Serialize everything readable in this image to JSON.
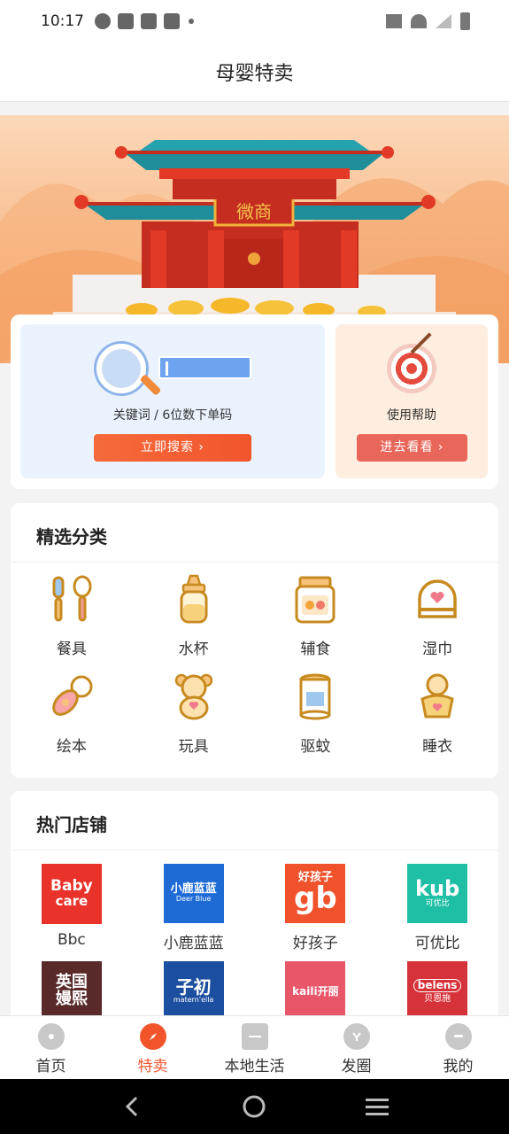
{
  "status_bar": {
    "time": "10:17"
  },
  "header": {
    "title": "母婴特卖"
  },
  "banner": {
    "sign_text": "微商"
  },
  "search_card": {
    "label": "关键词 / 6位数下单码",
    "button": "立即搜索 ›"
  },
  "help_card": {
    "label": "使用帮助",
    "button": "进去看看 ›"
  },
  "categories": {
    "title": "精选分类",
    "items": [
      {
        "label": "餐具",
        "icon": "tableware-icon"
      },
      {
        "label": "水杯",
        "icon": "baby-bottle-icon"
      },
      {
        "label": "辅食",
        "icon": "baby-food-jar-icon"
      },
      {
        "label": "湿巾",
        "icon": "wet-wipes-icon"
      },
      {
        "label": "绘本",
        "icon": "pacifier-icon"
      },
      {
        "label": "玩具",
        "icon": "teddy-bear-icon"
      },
      {
        "label": "驱蚊",
        "icon": "milk-powder-can-icon"
      },
      {
        "label": "睡衣",
        "icon": "baby-icon"
      }
    ]
  },
  "shops": {
    "title": "热门店铺",
    "items": [
      {
        "name": "Bbc",
        "logo_line1": "Baby",
        "logo_line2": "care",
        "color": "#e8322a"
      },
      {
        "name": "小鹿蓝蓝",
        "logo_line1": "小鹿蓝蓝",
        "logo_line2": "Deer Blue",
        "color": "#1e6bd6"
      },
      {
        "name": "好孩子",
        "logo_line1": "好孩子",
        "logo_line2": "gb",
        "color": "#f0522c"
      },
      {
        "name": "可优比",
        "logo_line1": "kub",
        "logo_line2": "可优比",
        "color": "#1fbfa6"
      },
      {
        "name": "",
        "logo_line1": "英国",
        "logo_line2": "嫚熙",
        "color": "#5a2a2a"
      },
      {
        "name": "",
        "logo_line1": "子初",
        "logo_line2": "matern'ella",
        "color": "#1d4fa0"
      },
      {
        "name": "",
        "logo_line1": "kaili开丽",
        "logo_line2": "",
        "color": "#e8566a"
      },
      {
        "name": "",
        "logo_line1": "belens",
        "logo_line2": "贝恩施",
        "color": "#d6323a"
      }
    ]
  },
  "tabbar": {
    "items": [
      {
        "label": "首页",
        "icon": "home-icon",
        "active": false
      },
      {
        "label": "特卖",
        "icon": "compass-icon",
        "active": true
      },
      {
        "label": "本地生活",
        "icon": "store-icon",
        "active": false
      },
      {
        "label": "发圈",
        "icon": "share-icon",
        "active": false
      },
      {
        "label": "我的",
        "icon": "profile-icon",
        "active": false
      }
    ]
  },
  "colors": {
    "accent": "#f2552c",
    "help_button": "#e8675a"
  }
}
